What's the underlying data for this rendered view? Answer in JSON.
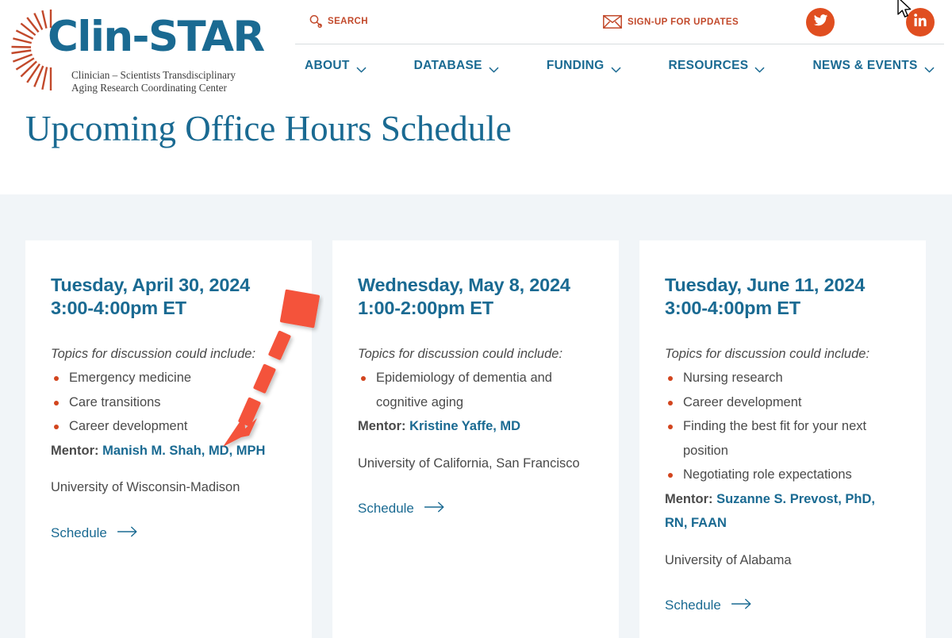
{
  "site": {
    "logo_wordmark": "Clin-STAR",
    "logo_tagline_line1": "Clinician – Scientists Transdisciplinary",
    "logo_tagline_line2": "Aging Research Coordinating Center",
    "sunburst_icon": "sunburst-rays-icon"
  },
  "utility": {
    "search_label": "SEARCH",
    "search_icon": "magnifying-glass-icon",
    "signup_label": "SIGN-UP FOR UPDATES",
    "signup_icon": "envelope-icon",
    "twitter_icon": "twitter-bird-icon",
    "linkedin_icon": "linkedin-in-icon",
    "accent_orange": "#e04e20",
    "link_orange": "#c2492b"
  },
  "nav": {
    "items": [
      {
        "label": "ABOUT",
        "has_dropdown": true
      },
      {
        "label": "DATABASE",
        "has_dropdown": true
      },
      {
        "label": "FUNDING",
        "has_dropdown": true
      },
      {
        "label": "RESOURCES",
        "has_dropdown": true
      },
      {
        "label": "NEWS & EVENTS",
        "has_dropdown": true
      }
    ],
    "chevron_icon": "chevron-down-icon",
    "link_color": "#1a6a92"
  },
  "header": {
    "page_title": "Upcoming Office Hours Schedule",
    "title_color": "#1a6a92"
  },
  "theme": {
    "page_background": "#ffffff",
    "body_background": "#f1f5f8",
    "card_background": "#ffffff",
    "brand_blue": "#1a6a92",
    "bullet_red": "#d2451e",
    "annotation_red": "#f4523b",
    "body_text": "#4a4a4a"
  },
  "cards": [
    {
      "date": "Tuesday, April 30, 2024",
      "time": "3:00-4:00pm ET",
      "intro": "Topics for discussion could include:",
      "topics": [
        "Emergency medicine",
        "Care transitions",
        "Career development"
      ],
      "mentor_label": "Mentor:",
      "mentor_name": "Manish M. Shah, MD, MPH",
      "affiliation": "University of Wisconsin-Madison",
      "schedule_label": "Schedule",
      "schedule_icon": "arrow-right-icon"
    },
    {
      "date": "Wednesday, May 8, 2024",
      "time": "1:00-2:00pm ET",
      "intro": "Topics for discussion could include:",
      "topics": [
        "Epidemiology of dementia and cognitive aging"
      ],
      "mentor_label": "Mentor:",
      "mentor_name": "Kristine Yaffe, MD",
      "affiliation": "University of California, San Francisco",
      "schedule_label": "Schedule",
      "schedule_icon": "arrow-right-icon"
    },
    {
      "date": "Tuesday, June 11, 2024",
      "time": "3:00-4:00pm ET",
      "intro": "Topics for discussion could include:",
      "topics": [
        "Nursing research",
        "Career development",
        "Finding the best fit for your next position",
        "Negotiating role expectations"
      ],
      "mentor_label": "Mentor:",
      "mentor_name": "Suzanne S. Prevost, PhD, RN, FAAN",
      "affiliation": "University of Alabama",
      "schedule_label": "Schedule",
      "schedule_icon": "arrow-right-icon"
    }
  ],
  "annotation": {
    "type": "dashed-arrow",
    "icon": "dashed-arrow-down-left-icon",
    "color": "#f4523b"
  },
  "cursor": {
    "icon": "mouse-pointer-icon"
  }
}
